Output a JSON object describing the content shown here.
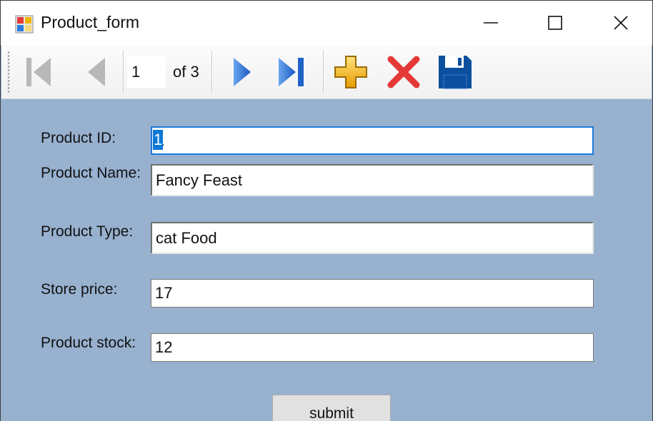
{
  "window": {
    "title": "Product_form",
    "icon": "app-form-icon"
  },
  "toolbar": {
    "position_value": "1",
    "count_label": "of 3",
    "buttons": {
      "first": "move-first-icon",
      "previous": "move-previous-icon",
      "next": "move-next-icon",
      "last": "move-last-icon",
      "add": "add-new-icon",
      "delete": "delete-icon",
      "save": "save-icon"
    }
  },
  "form": {
    "product_id": {
      "label": "Product ID:",
      "value": "1"
    },
    "product_name": {
      "label": "Product Name:",
      "value": "Fancy Feast"
    },
    "product_type": {
      "label": "Product Type:",
      "value": "cat Food"
    },
    "store_price": {
      "label": "Store price:",
      "value": "17"
    },
    "product_stock": {
      "label": "Product stock:",
      "value": "12"
    },
    "submit_label": "submit"
  },
  "colors": {
    "form_background": "#97b1cf",
    "nav_blue": "#1e63c8",
    "add_yellow": "#f0b400",
    "delete_red": "#e53935",
    "save_blue": "#0b4f9e",
    "focus_border": "#1f78d8"
  }
}
